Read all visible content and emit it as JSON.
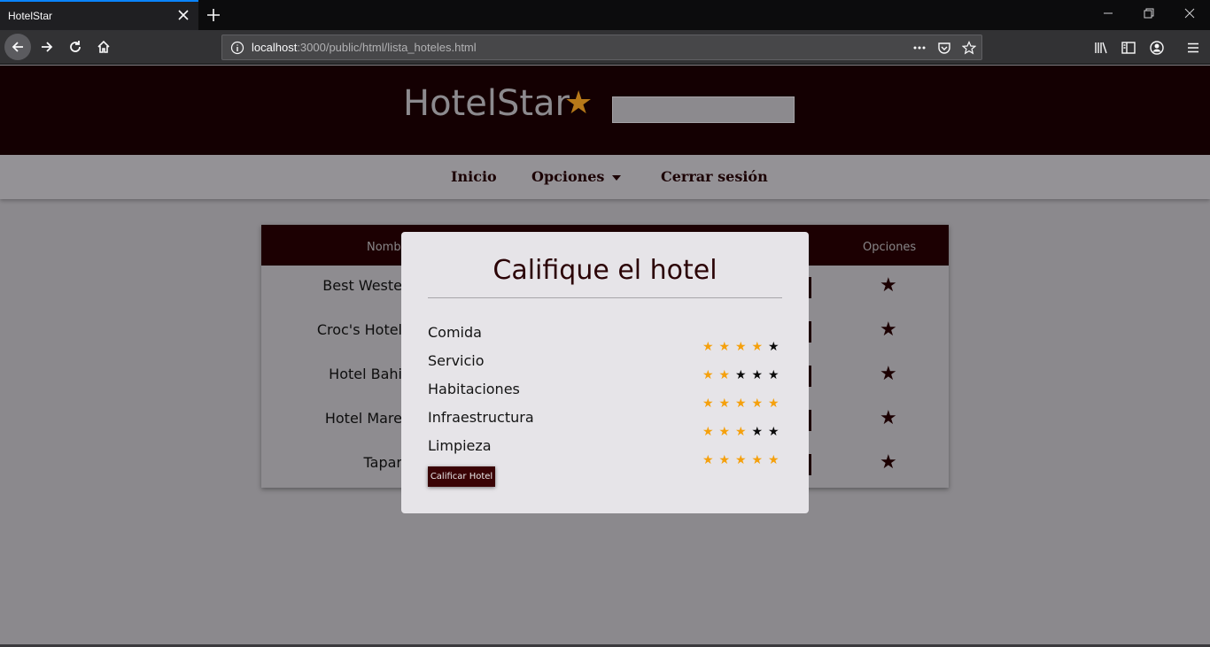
{
  "browser": {
    "tab_title": "HotelStar",
    "url_host": "localhost",
    "url_rest": ":3000/public/html/lista_hoteles.html"
  },
  "site": {
    "logo": "HotelStar",
    "logo_star": "★",
    "menu": [
      {
        "label": "Inicio"
      },
      {
        "label": "Opciones"
      },
      {
        "label": "Cerrar sesión"
      }
    ]
  },
  "table": {
    "headers": {
      "name": "Nomb",
      "options": "Opciones"
    },
    "rows": [
      {
        "name": "Best Weste"
      },
      {
        "name": "Croc's Hotel"
      },
      {
        "name": "Hotel Bahi"
      },
      {
        "name": "Hotel Mare"
      },
      {
        "name": "Tapar"
      }
    ]
  },
  "modal": {
    "title": "Califique el hotel",
    "criteria": [
      {
        "label": "Comida",
        "rating": 4
      },
      {
        "label": "Servicio",
        "rating": 2
      },
      {
        "label": "Habitaciones",
        "rating": 5
      },
      {
        "label": "Infraestructura",
        "rating": 3
      },
      {
        "label": "Limpieza",
        "rating": 5
      }
    ],
    "max_rating": 5,
    "submit_label": "Calificar Hotel"
  },
  "colors": {
    "star_on": "#f5a00c",
    "star_off": "#0b0b0b",
    "brand_dark": "#1c0002"
  }
}
